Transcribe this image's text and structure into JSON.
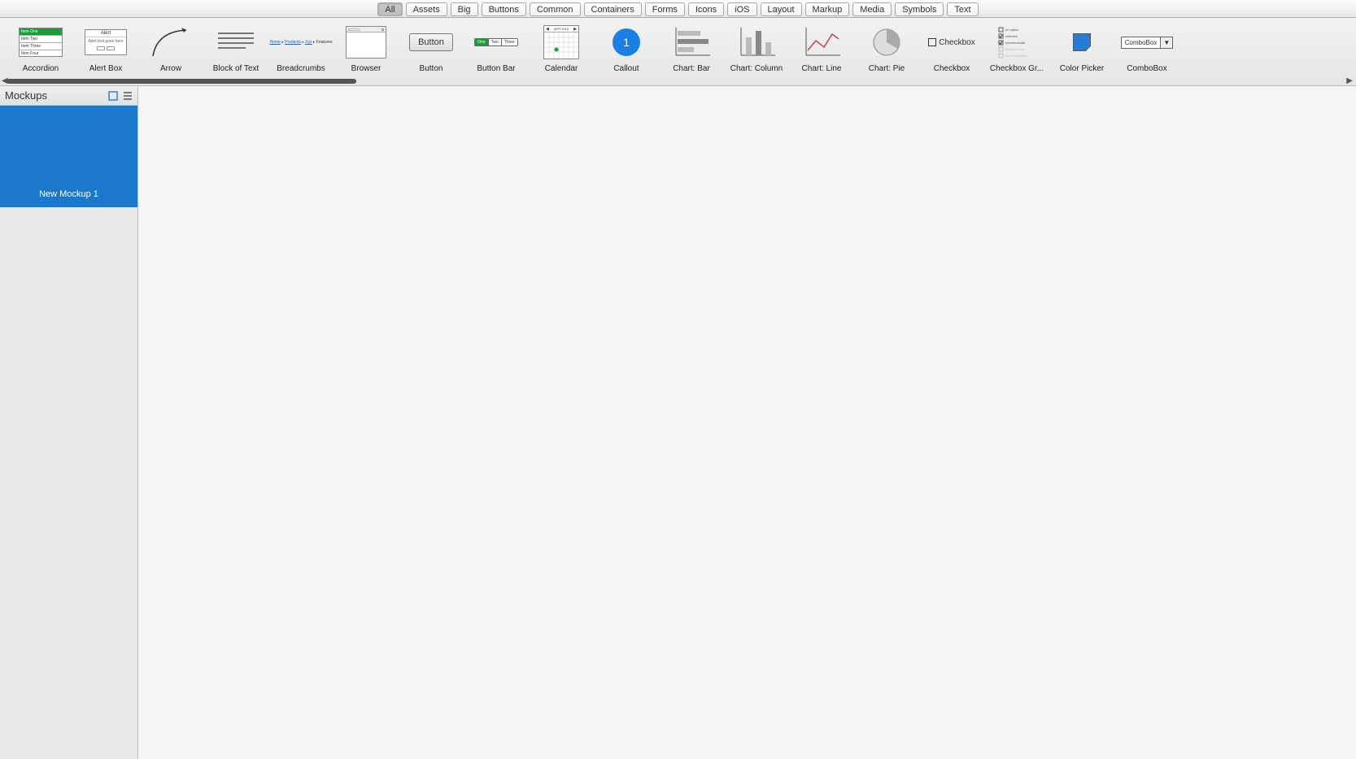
{
  "filters": {
    "active": "All",
    "items": [
      "All",
      "Assets",
      "Big",
      "Buttons",
      "Common",
      "Containers",
      "Forms",
      "Icons",
      "iOS",
      "Layout",
      "Markup",
      "Media",
      "Symbols",
      "Text"
    ]
  },
  "shelf": {
    "items": [
      {
        "label": "Accordion"
      },
      {
        "label": "Alert Box"
      },
      {
        "label": "Arrow"
      },
      {
        "label": "Block of Text"
      },
      {
        "label": "Breadcrumbs"
      },
      {
        "label": "Browser"
      },
      {
        "label": "Button"
      },
      {
        "label": "Button Bar"
      },
      {
        "label": "Calendar"
      },
      {
        "label": "Callout"
      },
      {
        "label": "Chart: Bar"
      },
      {
        "label": "Chart: Column"
      },
      {
        "label": "Chart: Line"
      },
      {
        "label": "Chart: Pie"
      },
      {
        "label": "Checkbox"
      },
      {
        "label": "Checkbox Gr..."
      },
      {
        "label": "Color Picker"
      },
      {
        "label": "ComboBox"
      }
    ],
    "callout_number": "1",
    "button_sample_text": "Button",
    "buttonbar": [
      "One",
      "Two",
      "Three"
    ],
    "checkbox_sample": "Checkbox",
    "combo_sample": "ComboBox",
    "accordion_rows": [
      "Item One",
      "Item Two",
      "Item Three",
      "Item Four"
    ],
    "alert_title": "Alert",
    "alert_body": "Alert text goes here",
    "breadcrumbs_parts": [
      "Home",
      "Products",
      "Xyz",
      "Features"
    ]
  },
  "sidebar": {
    "title": "Mockups",
    "items": [
      {
        "label": "New Mockup 1"
      }
    ]
  }
}
